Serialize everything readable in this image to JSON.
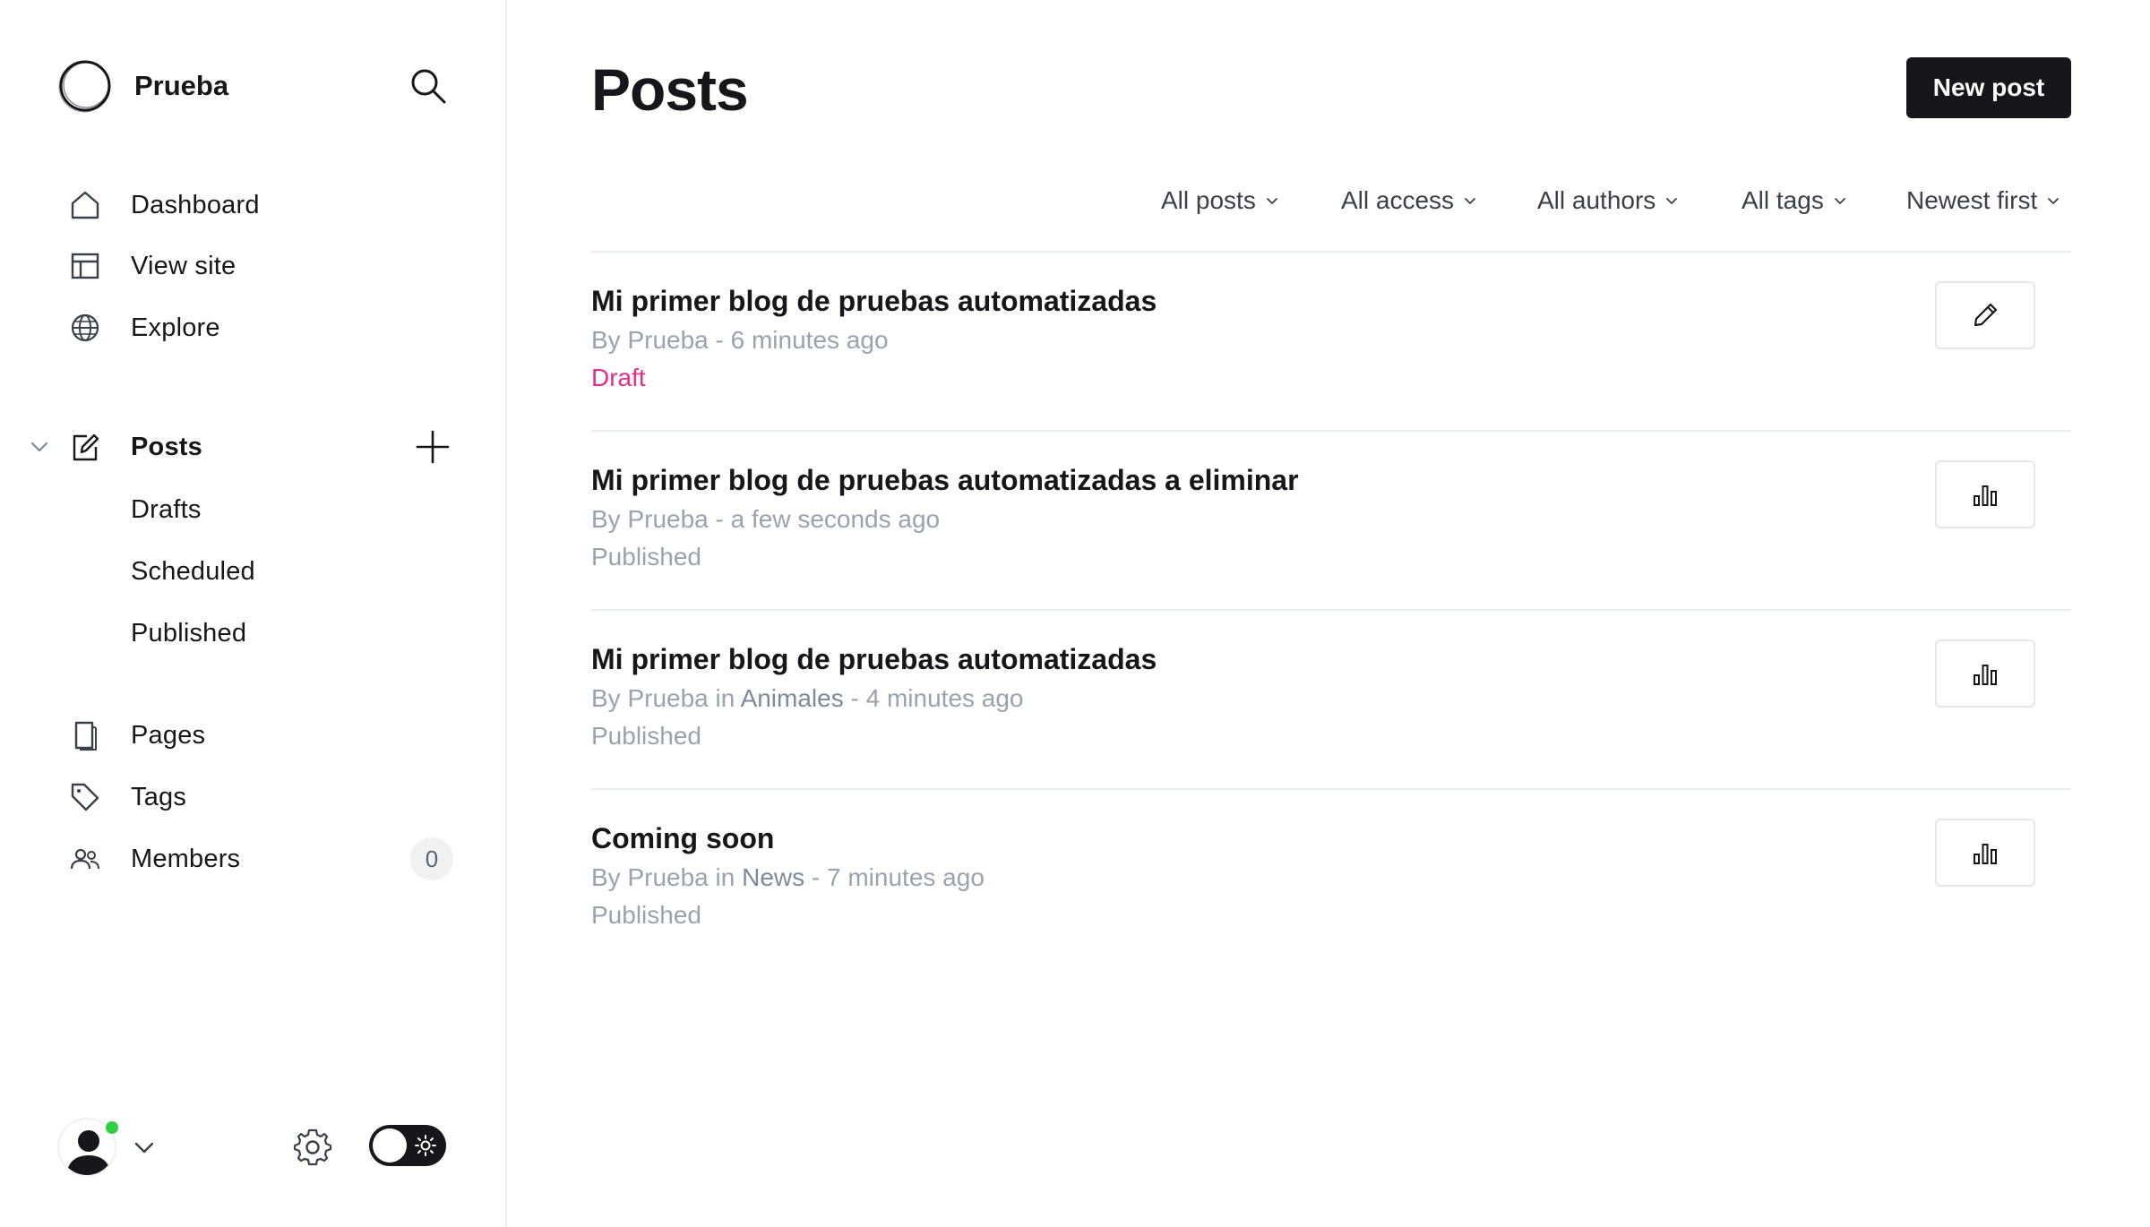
{
  "brand": {
    "name": "Prueba",
    "logo_icon": "circle-logo-icon"
  },
  "sidebar": {
    "primary": [
      {
        "label": "Dashboard",
        "icon": "home-icon"
      },
      {
        "label": "View site",
        "icon": "layout-icon"
      },
      {
        "label": "Explore",
        "icon": "globe-icon"
      }
    ],
    "posts": {
      "label": "Posts",
      "icon": "edit-icon",
      "sub": [
        "Drafts",
        "Scheduled",
        "Published"
      ]
    },
    "secondary": [
      {
        "label": "Pages",
        "icon": "page-icon"
      },
      {
        "label": "Tags",
        "icon": "tag-icon"
      },
      {
        "label": "Members",
        "icon": "members-icon",
        "count": "0"
      }
    ]
  },
  "header": {
    "title": "Posts",
    "new_post_label": "New post"
  },
  "filters": [
    "All posts",
    "All access",
    "All authors",
    "All tags",
    "Newest first"
  ],
  "posts": [
    {
      "title": "Mi primer blog de pruebas automatizadas",
      "meta_prefix": "By Prueba",
      "meta_in": "",
      "meta_tag": "",
      "meta_time": " - 6 minutes ago",
      "status": "Draft",
      "action_icon": "pencil-icon"
    },
    {
      "title": "Mi primer blog de pruebas automatizadas a eliminar",
      "meta_prefix": "By Prueba",
      "meta_in": "",
      "meta_tag": "",
      "meta_time": " - a few seconds ago",
      "status": "Published",
      "action_icon": "analytics-icon"
    },
    {
      "title": "Mi primer blog de pruebas automatizadas",
      "meta_prefix": "By Prueba",
      "meta_in": " in ",
      "meta_tag": "Animales",
      "meta_time": " - 4 minutes ago",
      "status": "Published",
      "action_icon": "analytics-icon"
    },
    {
      "title": "Coming soon",
      "meta_prefix": "By Prueba",
      "meta_in": " in ",
      "meta_tag": "News",
      "meta_time": " - 7 minutes ago",
      "status": "Published",
      "action_icon": "analytics-icon"
    }
  ],
  "colors": {
    "accent_dark": "#15171a",
    "draft": "#e32d87",
    "muted": "#99a3ad",
    "online": "#30cf43"
  }
}
